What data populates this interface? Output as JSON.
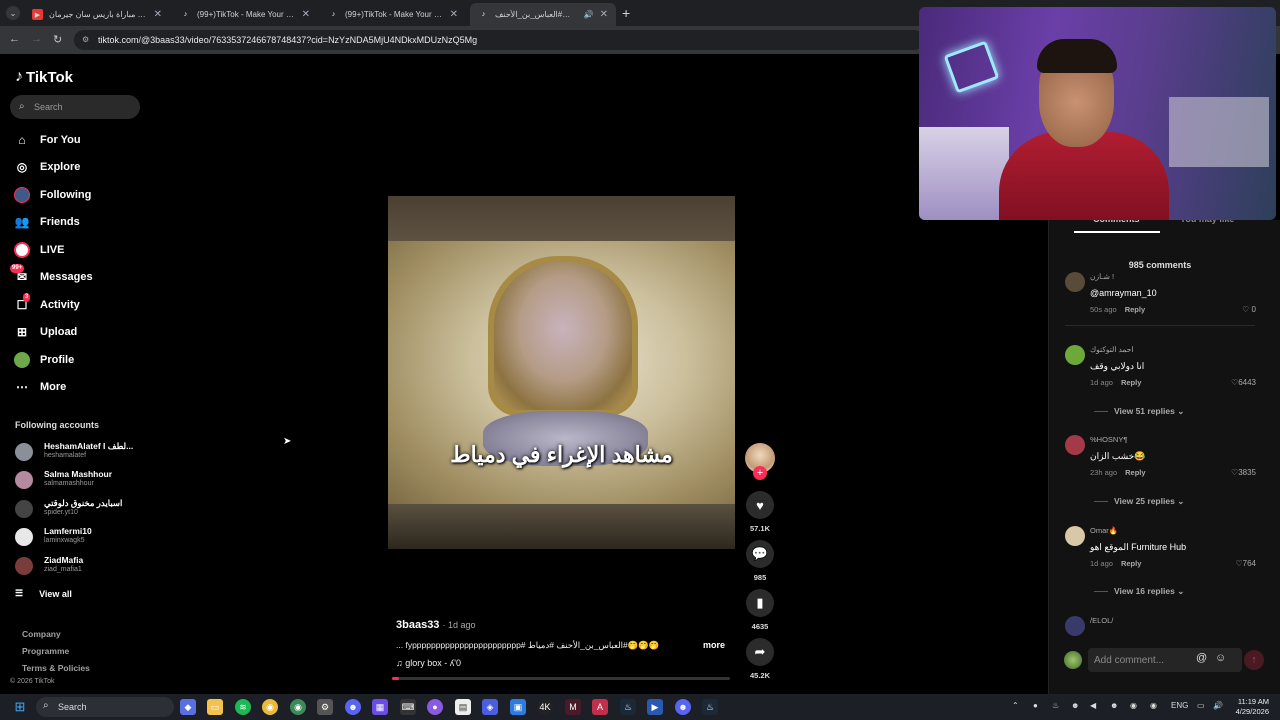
{
  "browser": {
    "tabs": [
      {
        "label": "ملخص مباراة باريس سان جيرمان",
        "active": false,
        "icon_color": "#e53935"
      },
      {
        "label": "(99+)TikTok - Make Your Day",
        "active": false,
        "icon_color": "#111111"
      },
      {
        "label": "(99+)TikTok - Make Your Day",
        "active": false,
        "icon_color": "#111111"
      },
      {
        "label": "العباس_بن_الأحنف#🤭🤭🤭",
        "active": true,
        "icon_color": "#111111"
      }
    ],
    "url": "tiktok.com/@3baas33/video/7633537246678748437?cid=NzYzNDA5MjU4NDkxMDUzNzQ5Mg"
  },
  "sidebar": {
    "logo": "TikTok",
    "search_placeholder": "Search",
    "nav": [
      {
        "label": "For You",
        "icon": "home-icon"
      },
      {
        "label": "Explore",
        "icon": "compass-icon"
      },
      {
        "label": "Following",
        "icon": "following-icon"
      },
      {
        "label": "Friends",
        "icon": "friends-icon"
      },
      {
        "label": "LIVE",
        "icon": "live-icon"
      },
      {
        "label": "Messages",
        "icon": "messages-icon",
        "badge": "99+"
      },
      {
        "label": "Activity",
        "icon": "activity-icon",
        "badge": "3"
      },
      {
        "label": "Upload",
        "icon": "upload-icon"
      },
      {
        "label": "Profile",
        "icon": "profile-icon"
      },
      {
        "label": "More",
        "icon": "more-icon"
      }
    ],
    "following_title": "Following accounts",
    "accounts": [
      {
        "name": "HeshamAlatef I لطف...",
        "handle": "heshamalatef",
        "color": "#8a8f99"
      },
      {
        "name": "Salma Mashhour",
        "handle": "salmamashhour",
        "color": "#b58aa0"
      },
      {
        "name": "اسبايدر مخنوق دلوقتي",
        "handle": "spider.yt10",
        "color": "#444444"
      },
      {
        "name": "Lamfermi10",
        "handle": "laminxwagk5",
        "color": "#e8e8e8"
      },
      {
        "name": "ZiadMafia",
        "handle": "ziad_mafia1",
        "color": "#7a3b3b"
      }
    ],
    "view_all": "View all",
    "footer": [
      "Company",
      "Programme",
      "Terms & Policies"
    ],
    "copyright": "© 2026 TikTok"
  },
  "video": {
    "caption": "مشاهد الإغراء في دمياط",
    "author": "3baas33",
    "ago": "· 1d ago",
    "description": "🤭🤭🤭#العباس_بن_الأحنف #دمياط #fyppppppppppppppppppppppp ...",
    "more": "more",
    "music": "♫  glory box - ʎ'0",
    "progress": 0.02,
    "actions": {
      "likes": "57.1K",
      "comments": "985",
      "saves": "4635",
      "shares": "45.2K"
    }
  },
  "panel": {
    "tabs": [
      "Comments",
      "You may like"
    ],
    "count": "985 comments",
    "comments": [
      {
        "user": "شـازن !",
        "text": "@amrayman_10",
        "ago": "50s ago",
        "reply": "Reply",
        "likes": "0",
        "color": "#5a4a3a"
      },
      {
        "user": "احمد التوكتوك",
        "text": "انا دولابي وقف",
        "ago": "1d ago",
        "reply": "Reply",
        "likes": "6443",
        "color": "#6fa83a",
        "replies": "View 51 replies"
      },
      {
        "user": "%HOSNY¶",
        "text": "خشب الزان😂",
        "ago": "23h ago",
        "reply": "Reply",
        "likes": "3835",
        "color": "#a33a4a",
        "replies": "View 25 replies"
      },
      {
        "user": "Omar🔥",
        "text": "الموقع اهو Furniture Hub",
        "ago": "1d ago",
        "reply": "Reply",
        "likes": "764",
        "color": "#d8c8a8",
        "replies": "View 16 replies"
      },
      {
        "user": "/ELOL/",
        "text": "",
        "ago": "",
        "reply": "",
        "likes": "",
        "color": "#3a3a6a"
      }
    ],
    "input_placeholder": "Add comment..."
  },
  "taskbar": {
    "search": "Search",
    "lang": "ENG",
    "time": "11:19 AM",
    "date": "4/29/2026"
  }
}
